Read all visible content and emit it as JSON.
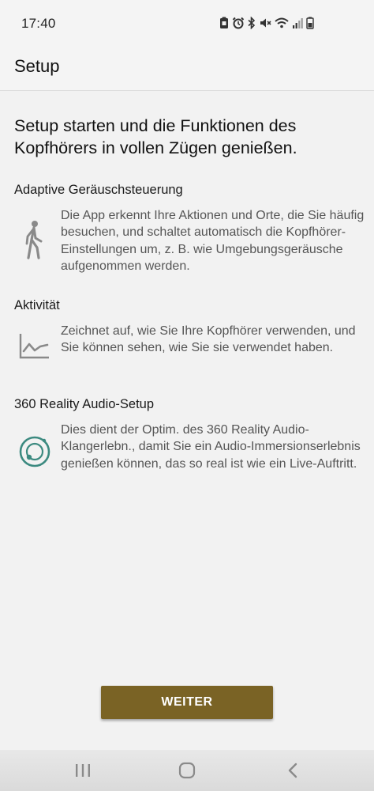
{
  "status_bar": {
    "time": "17:40",
    "icons": [
      "screenshot-icon",
      "alarm-icon",
      "bluetooth-icon",
      "mute-icon",
      "wifi-icon",
      "signal-icon",
      "battery-icon"
    ]
  },
  "app_bar": {
    "title": "Setup"
  },
  "headline": "Setup starten und die Funktionen des Kopfhörers in vollen Zügen genießen.",
  "sections": [
    {
      "title": "Adaptive Geräuschsteuerung",
      "description": "Die App erkennt Ihre Aktionen und Orte, die Sie häufig besuchen, und schaltet automatisch die Kopfhörer-Einstellungen um, z. B. wie Umgebungsgeräusche aufgenommen werden.",
      "icon": "walking-person-icon"
    },
    {
      "title": "Aktivität",
      "description": "Zeichnet auf, wie Sie Ihre Kopfhörer verwenden, und Sie können sehen, wie Sie sie verwendet haben.",
      "icon": "activity-chart-icon"
    },
    {
      "title": "360 Reality Audio-Setup",
      "description": "Dies dient der Optim. des 360 Reality Audio-Klangerlebn., damit Sie ein Audio-Immersionserlebnis genießen können, das so real ist wie ein Live-Auftritt.",
      "icon": "reality-audio-icon"
    }
  ],
  "button": {
    "label": "WEITER"
  },
  "colors": {
    "button": "#7a6325",
    "accent_teal": "#3c8a80",
    "background": "#f2f2f2"
  },
  "nav_bar": {
    "icons": [
      "recent-apps-icon",
      "home-icon",
      "back-icon"
    ]
  }
}
